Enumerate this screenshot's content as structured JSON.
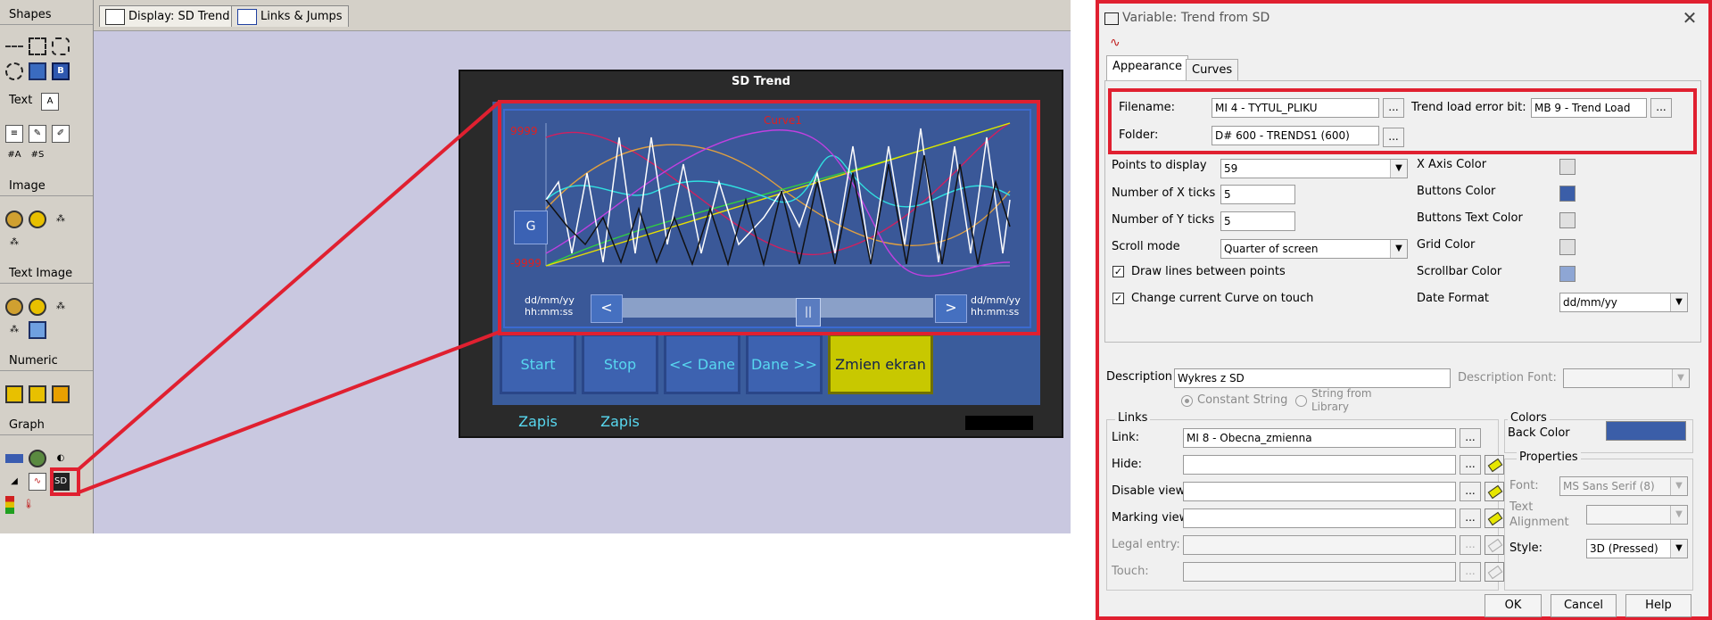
{
  "toolbox": {
    "shapes_label": "Shapes",
    "text_label": "Text",
    "image_label": "Image",
    "text_image_label": "Text Image",
    "numeric_label": "Numeric",
    "graph_label": "Graph",
    "text_icon_labels": [
      "#A",
      "#S"
    ]
  },
  "editor_tabs": [
    {
      "label": "Display: SD Trend"
    },
    {
      "label": "Links & Jumps"
    }
  ],
  "hmi": {
    "title": "SD Trend",
    "curve_label": "Curve1",
    "y_max": "9999",
    "y_min": "-9999",
    "g_button": "G",
    "date_left": [
      "dd/mm/yy",
      "hh:mm:ss"
    ],
    "date_right": [
      "dd/mm/yy",
      "hh:mm:ss"
    ],
    "scroll_left": "<",
    "scroll_right": ">",
    "scroll_thumb": "||",
    "buttons": [
      "Start Zapis",
      "Stop Zapis",
      "<< Dane",
      "Dane >>",
      "Zmien ekran"
    ]
  },
  "dialog": {
    "title": "Variable: Trend from SD",
    "close": "✕",
    "tabs": [
      "Appearance",
      "Curves"
    ],
    "filename_label": "Filename:",
    "filename_value": "MI 4  - TYTUL_PLIKU",
    "folder_label": "Folder:",
    "folder_value": "D# 600  - TRENDS1 (600)",
    "trend_err_label": "Trend load error bit:",
    "trend_err_value": "MB 9  - Trend Load",
    "dots": "...",
    "points_label": "Points to display",
    "points_value": "59",
    "xticks_label": "Number of X ticks",
    "xticks_value": "5",
    "yticks_label": "Number of Y ticks",
    "yticks_value": "5",
    "scroll_mode_label": "Scroll mode",
    "scroll_mode_value": "Quarter of screen",
    "draw_lines_label": "Draw lines between points",
    "change_curve_label": "Change current Curve on touch",
    "check_mark": "✓",
    "xaxis_color_label": "X Axis Color",
    "buttons_color_label": "Buttons Color",
    "buttons_text_color_label": "Buttons Text Color",
    "grid_color_label": "Grid Color",
    "scrollbar_color_label": "Scrollbar Color",
    "date_format_label": "Date Format",
    "date_format_value": "dd/mm/yy",
    "colors": {
      "xaxis": "#e0e0e0",
      "buttons": "#3b5ea8",
      "buttons_text": "#e0e0e0",
      "grid": "#e0e0e0",
      "scrollbar": "#8ea6d4",
      "back": "#3b5ea8"
    },
    "description_label": "Description",
    "description_value": "Wykres z SD",
    "description_font_label": "Description Font:",
    "constant_string_label": "Constant String",
    "string_library_label": [
      "String from",
      "Library"
    ],
    "links_group": "Links",
    "link_label": "Link:",
    "link_value": "MI 8  - Obecna_zmienna",
    "hide_label": "Hide:",
    "disable_view_label": "Disable view:",
    "marking_view_label": "Marking view:",
    "legal_entry_label": "Legal entry:",
    "touch_label": "Touch:",
    "colors_group": "Colors",
    "back_color_label": "Back Color",
    "properties_group": "Properties",
    "font_label": "Font:",
    "font_value": "MS Sans Serif (8)",
    "text_alignment_label": [
      "Text",
      "Alignment"
    ],
    "style_label": "Style:",
    "style_value": "3D (Pressed)",
    "ok": "OK",
    "cancel": "Cancel",
    "help": "Help"
  }
}
